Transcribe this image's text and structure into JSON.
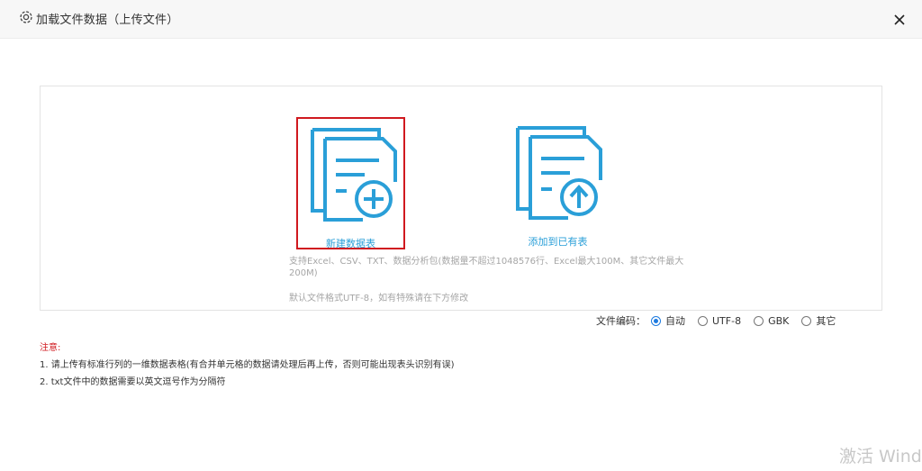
{
  "dialog": {
    "title": "加载文件数据（上传文件）"
  },
  "options": {
    "new_table_label": "新建数据表",
    "add_to_existing_label": "添加到已有表"
  },
  "hints": {
    "support": "支持Excel、CSV、TXT、数据分析包(数据量不超过1048576行、Excel最大100M、其它文件最大200M)",
    "encoding_default": "默认文件格式UTF-8，如有特殊请在下方修改"
  },
  "encoding": {
    "label": "文件编码：",
    "options": [
      "自动",
      "UTF-8",
      "GBK",
      "其它"
    ],
    "selected": "自动"
  },
  "notes": {
    "title": "注意:",
    "lines": [
      "1. 请上传有标准行列的一维数据表格(有合并单元格的数据请处理后再上传，否则可能出现表头识别有误)",
      "2. txt文件中的数据需要以英文逗号作为分隔符"
    ]
  },
  "watermark": "激活 Wind",
  "colors": {
    "accent_blue": "#2a9fd8",
    "highlight_red": "#d0191f",
    "radio_blue": "#1e7be0"
  }
}
